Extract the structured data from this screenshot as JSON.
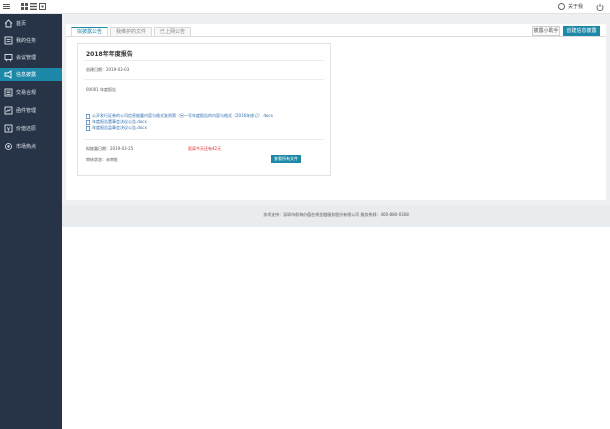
{
  "topbar": {
    "icons": [
      "menu-icon",
      "grid-icon",
      "list-icon",
      "apps-icon"
    ],
    "user_name": "关于我",
    "power_icon": "power-icon"
  },
  "sidebar": {
    "items": [
      {
        "label": "首页",
        "icon": "home-icon"
      },
      {
        "label": "我的任务",
        "icon": "tasks-icon"
      },
      {
        "label": "会议管理",
        "icon": "meeting-icon"
      },
      {
        "label": "信息披露",
        "icon": "disclosure-icon"
      },
      {
        "label": "交易合规",
        "icon": "compliance-icon"
      },
      {
        "label": "函件管理",
        "icon": "letters-icon"
      },
      {
        "label": "价值还原",
        "icon": "value-icon"
      },
      {
        "label": "市场热点",
        "icon": "hotspot-icon"
      }
    ],
    "active_index": 3
  },
  "tabs": [
    "拟披露公告",
    "我维护的文件",
    "已上网公告"
  ],
  "actions": {
    "help": "披露小助手",
    "create": "创建信息披露"
  },
  "card": {
    "title": "2018年年度报告",
    "created": "创建日期：2019-03-03",
    "summary": "00001 年度报告",
    "files": [
      "公开发行证券的公司信息披露内容与格式准则第（另一号年度报告的内容与格式（2016年修订）.docx",
      "年度报告董事会决议公告.docx",
      "年度报告监事会决议公告.docx"
    ],
    "deadline_label": "拟披露日期：2019-03-25",
    "remaining": "距离今天还有42天",
    "status_label": "审核状态：未审批",
    "view_button": "查看所有文件"
  },
  "footer": {
    "text": "技术支持：深圳市前海价值在线金融服务股份有限公司    服务热线：400-880-0308"
  },
  "colors": {
    "accent": "#1e88a8",
    "sidebar_bg": "#273447",
    "warning": "#e02424",
    "link": "#2b6cb0"
  }
}
